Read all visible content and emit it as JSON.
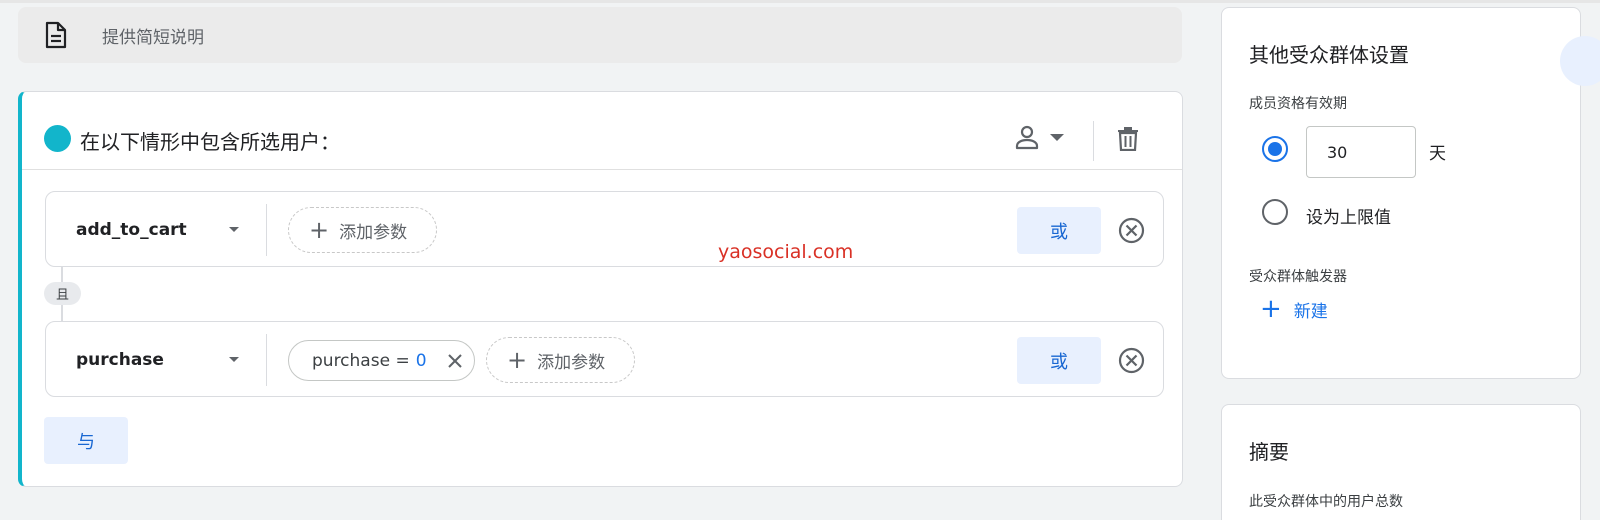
{
  "description": {
    "placeholder": "提供简短说明",
    "icon": "document-icon"
  },
  "condition_card": {
    "title": "在以下情形中包含所选用户：",
    "accent_color": "#12b5cb",
    "events": [
      {
        "name": "add_to_cart",
        "params": [],
        "add_param_label": "添加参数",
        "or_label": "或"
      },
      {
        "name": "purchase",
        "params": [
          {
            "key": "purchase =",
            "value": "0"
          }
        ],
        "add_param_label": "添加参数",
        "or_label": "或"
      }
    ],
    "and_label": "且",
    "with_label": "与"
  },
  "watermark": "yaosocial.com",
  "settings_panel": {
    "title": "其他受众群体设置",
    "membership_label": "成员资格有效期",
    "days_value": "30",
    "days_unit": "天",
    "max_option_label": "设为上限值",
    "trigger_label": "受众群体触发器",
    "new_label": "新建"
  },
  "summary_panel": {
    "title": "摘要",
    "total_users_label": "此受众群体中的用户总数"
  }
}
